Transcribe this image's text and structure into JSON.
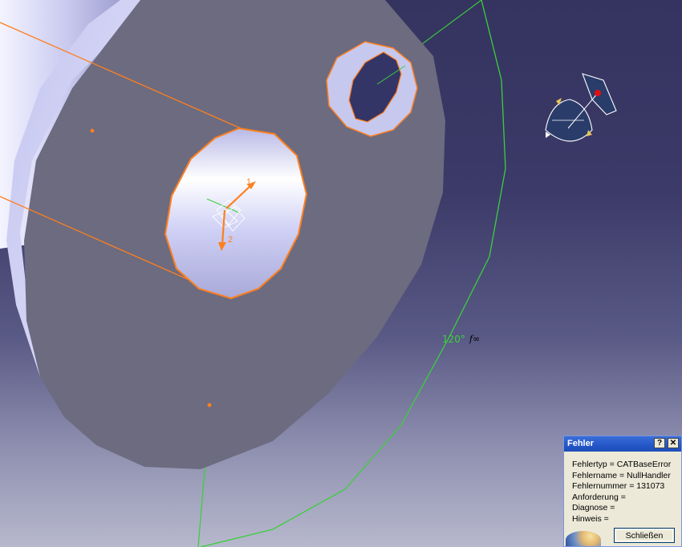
{
  "viewport": {
    "angle_label": "120°",
    "infinity_label": "f∞",
    "colors": {
      "bg_top": "#35335f",
      "part": "#6c6b80",
      "shaft": "#c8c9ec",
      "edge_highlight": "#ff7f1e",
      "sketch_line": "#3ccf3c"
    },
    "axis_labels": {
      "axis1": "1",
      "axis2": "2"
    }
  },
  "dialog": {
    "title": "Fehler",
    "help_label": "?",
    "close_label": "✕",
    "lines": [
      "Fehlertyp = CATBaseError",
      "Fehlername = NullHandler",
      "Fehlernummer = 131073",
      "Anforderung =",
      "Diagnose =",
      "Hinweis ="
    ],
    "close_button": "Schließen"
  }
}
